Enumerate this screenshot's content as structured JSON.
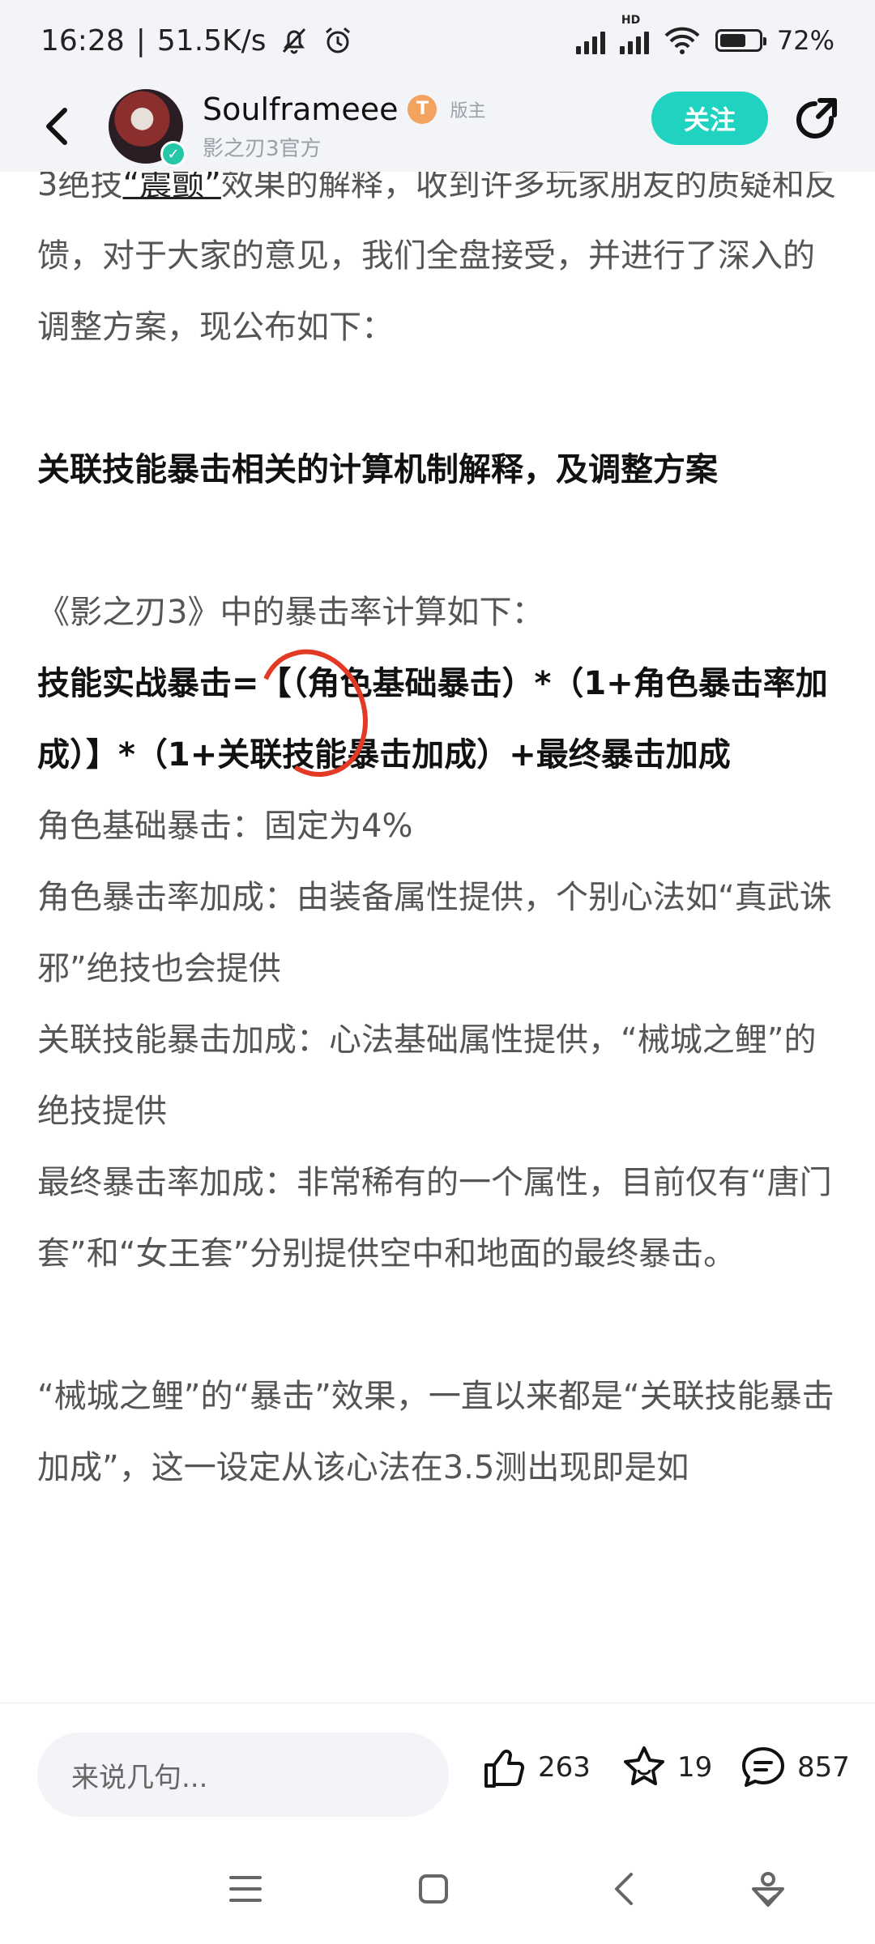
{
  "status_bar": {
    "time": "16:28",
    "network_speed": "51.5K/s",
    "battery": "72%",
    "battery_level": 0.72,
    "hd_label": "HD"
  },
  "header": {
    "username": "Soulframeee",
    "level_badge": "T",
    "role": "版主",
    "subtitle": "影之刃3官方",
    "follow_label": "关注"
  },
  "post": {
    "para1_a": "3绝技",
    "para1_b": "“震颤”",
    "para1_c": "效果的解释，收到许多玩家朋友的质疑和反馈，对于大家的意见，我们全盘接受，并进行了深入的调整方案，现公布如下：",
    "heading": "关联技能暴击相关的计算机制解释，及调整方案",
    "intro": "《影之刃3》中的暴击率计算如下：",
    "formula": "技能实战暴击=【（角色基础暴击）*（1+角色暴击率加成）】*（1+关联技能暴击加成）+最终暴击加成",
    "line_base": "角色基础暴击：固定为4%",
    "line_crit_rate": "角色暴击率加成：由装备属性提供，个别心法如“真武诛邪”绝技也会提供",
    "line_linked": "关联技能暴击加成：心法基础属性提供，“械城之鲤”的绝技提供",
    "line_final": "最终暴击率加成：非常稀有的一个属性，目前仅有“唐门套”和“女王套”分别提供空中和地面的最终暴击。",
    "para_last": "“械城之鲤”的“暴击”效果，一直以来都是“关联技能暴击加成”，这一设定从该心法在3.5测出现即是如"
  },
  "action_bar": {
    "comment_placeholder": "来说几句...",
    "likes": "263",
    "favorites": "19",
    "comments": "857"
  }
}
